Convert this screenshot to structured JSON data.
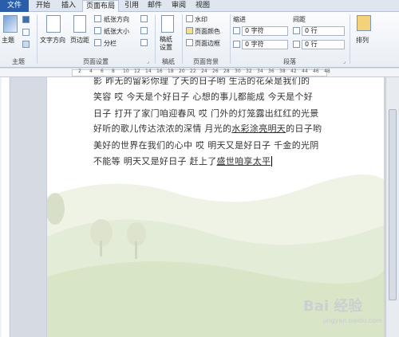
{
  "tabs": [
    {
      "name": "file",
      "label": "文件"
    },
    {
      "name": "start",
      "label": "开始"
    },
    {
      "name": "insert",
      "label": "插入"
    },
    {
      "name": "layout",
      "label": "页面布局"
    },
    {
      "name": "ref",
      "label": "引用"
    },
    {
      "name": "mail",
      "label": "邮件"
    },
    {
      "name": "review",
      "label": "审阅"
    },
    {
      "name": "view",
      "label": "视图"
    }
  ],
  "ribbon": {
    "theme": {
      "label": "主题",
      "group": "主题"
    },
    "text_direction": "文字方向",
    "margins": "页边距",
    "orientation": "纸张方向",
    "size": "纸张大小",
    "columns": "分栏",
    "page_setup_group": "页面设置",
    "manuscript": "稿纸\n设置",
    "manuscript_group": "稿纸",
    "watermark": "水印",
    "page_color": "页面颜色",
    "page_border": "页面边框",
    "page_bg_group": "页面背景",
    "indent_label": "缩进",
    "spacing_label": "间距",
    "indent_left": "0 字符",
    "indent_right": "0 字符",
    "spacing_before": "0 行",
    "spacing_after": "0 行",
    "paragraph_group": "段落",
    "arrange": "排列"
  },
  "ruler": {
    "numbers": [
      "2",
      "4",
      "6",
      "8",
      "10",
      "12",
      "14",
      "16",
      "18",
      "20",
      "22",
      "24",
      "26",
      "28",
      "30",
      "32",
      "34",
      "36",
      "38",
      "42",
      "44",
      "46",
      "48"
    ]
  },
  "document": {
    "lines": [
      "影  昨无的留彩你理  了天的日子哟  生活的花朵是我们的",
      "笑容  哎  今天是个好日子  心想的事儿都能成  今天是个好",
      "日子  打开了家门咱迎春风  哎  门外的灯笼露出红红的光景",
      "好听的歌儿传达浓浓的深情  月光的",
      "美好的世界在我们的心中  哎  明天又是好日子  千金的光阴",
      "不能等  明天又是好日子  赶上了"
    ],
    "line4_underlined": "水彩涂亮明天",
    "line4_tail": "的日子哟",
    "line6_underlined": "盛世咱享太平"
  },
  "watermark": {
    "main": "Bai 经验",
    "sub": "jingyan.baidu.com"
  }
}
